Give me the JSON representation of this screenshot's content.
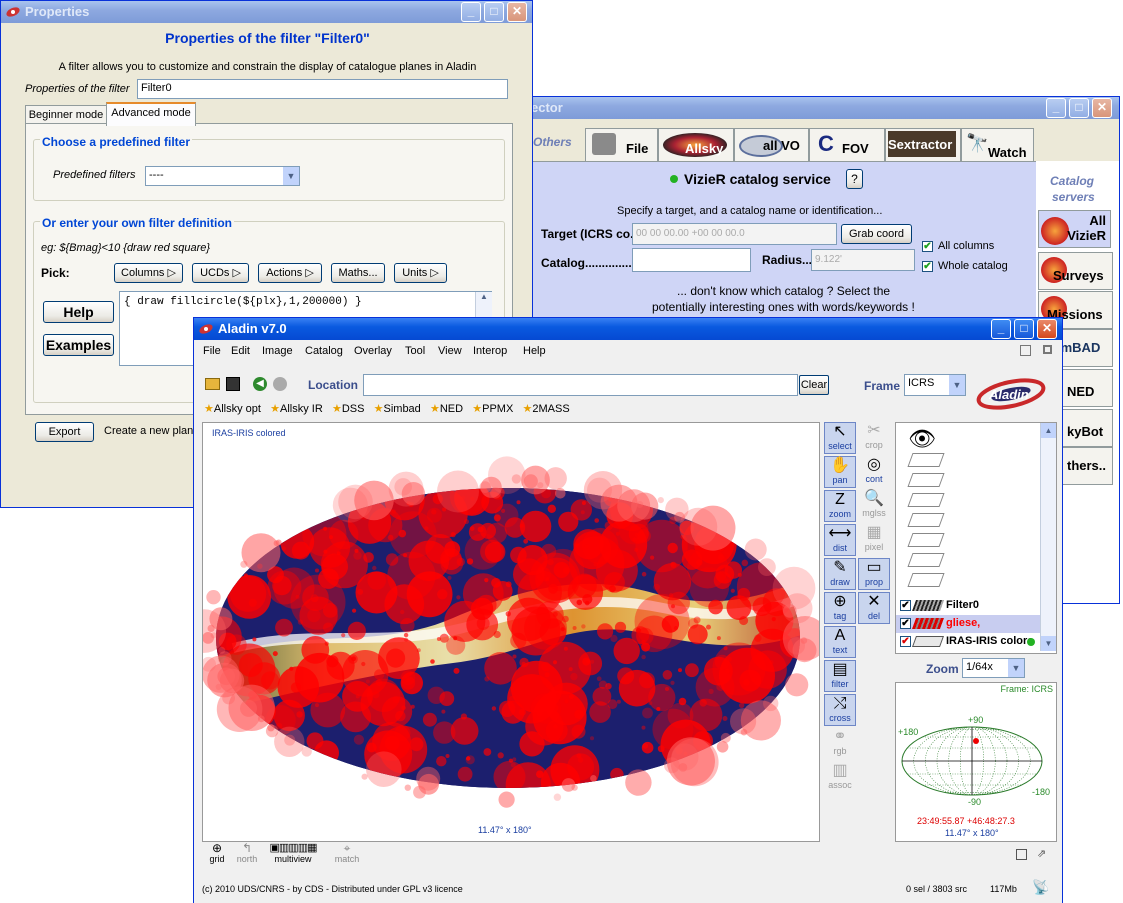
{
  "props": {
    "title": "Properties",
    "heading": "Properties of the filter \"Filter0\"",
    "description": "A filter allows you to customize and constrain the display of catalogue planes in Aladin",
    "name_label": "Properties of the filter",
    "name_value": "Filter0",
    "tab_beginner": "Beginner mode",
    "tab_advanced": "Advanced mode",
    "section1": "Choose a predefined filter",
    "predefined_label": "Predefined filters",
    "predefined_value": "----",
    "section2": "Or enter your own filter definition",
    "example": "eg: ${Bmag}<10 {draw red square}",
    "pick": "Pick:",
    "pick_buttons": [
      "Columns ▷",
      "UCDs ▷",
      "Actions ▷",
      "Maths...",
      "Units ▷"
    ],
    "help": "Help",
    "examples": "Examples",
    "filter_text": "{ draw fillcircle(${plx},1,200000) }",
    "export": "Export",
    "create": "Create a new plane"
  },
  "server": {
    "title_partial": "ector",
    "tabs": [
      "Others",
      "File",
      "Allsky",
      "all VO",
      "FOV",
      "Sextractor",
      "Watch"
    ],
    "service": "VizieR catalog service",
    "help": "?",
    "intro": "Specify a target, and a catalog name or identification...",
    "target_label": "Target (ICRS co.",
    "target_placeholder": "00 00 00.00 +00 00 00.0",
    "grab": "Grab coord",
    "catalog_label": "Catalog...............",
    "radius_label": "Radius...",
    "radius_value": "9.122'",
    "all_columns": "All columns",
    "whole_catalog": "Whole catalog",
    "hint1": "... don't know which catalog ? Select the",
    "hint2": "potentially interesting ones with words/keywords !",
    "servers_title1": "Catalog",
    "servers_title2": "servers",
    "servers": [
      "All\nVizieR",
      "Surveys",
      "Missions",
      "imBAD",
      "NED",
      "kyBot",
      "thers.."
    ]
  },
  "aladin": {
    "title": "Aladin v7.0",
    "menu": [
      "File",
      "Edit",
      "Image",
      "Catalog",
      "Overlay",
      "Tool",
      "View",
      "Interop",
      "Help"
    ],
    "location_label": "Location",
    "location_value": "",
    "clear": "Clear",
    "frame_label": "Frame",
    "frame_value": "ICRS",
    "logo": "Aladin",
    "bookmarks": [
      "Allsky opt",
      "Allsky IR",
      "DSS",
      "Simbad",
      "NED",
      "PPMX",
      "2MASS"
    ],
    "image_label": "IRAS-IRIS colored",
    "fov_label": "11.47° x 180°",
    "tools": [
      {
        "id": "select",
        "label": "select",
        "glyph": "↖"
      },
      {
        "id": "crop",
        "label": "crop",
        "glyph": "✂"
      },
      {
        "id": "pan",
        "label": "pan",
        "glyph": "✋"
      },
      {
        "id": "cont",
        "label": "cont",
        "glyph": "◎"
      },
      {
        "id": "zoom",
        "label": "zoom",
        "glyph": "Z"
      },
      {
        "id": "mglss",
        "label": "mglss",
        "glyph": "🔍"
      },
      {
        "id": "dist",
        "label": "dist",
        "glyph": "⟷"
      },
      {
        "id": "pixel",
        "label": "pixel",
        "glyph": "▦"
      },
      {
        "id": "draw",
        "label": "draw",
        "glyph": "✎"
      },
      {
        "id": "prop",
        "label": "prop",
        "glyph": "▭"
      },
      {
        "id": "tag",
        "label": "tag",
        "glyph": "⊕"
      },
      {
        "id": "del",
        "label": "del",
        "glyph": "✕"
      },
      {
        "id": "text",
        "label": "text",
        "glyph": "A"
      },
      {
        "id": "filter",
        "label": "filter",
        "glyph": "▤"
      },
      {
        "id": "cross",
        "label": "cross",
        "glyph": "⤭"
      },
      {
        "id": "rgb",
        "label": "rgb",
        "glyph": "⚭"
      },
      {
        "id": "assoc",
        "label": "assoc",
        "glyph": "▥"
      }
    ],
    "planes": [
      {
        "name": "Filter0",
        "color": "#000000"
      },
      {
        "name": "gliese,",
        "color": "#ff0000"
      },
      {
        "name": "IRAS-IRIS colore",
        "color": "#000000"
      }
    ],
    "zoom_label": "Zoom",
    "zoom_value": "1/64x",
    "frame_icrs": "Frame: ICRS",
    "grid_labels": {
      "top": "+90",
      "left": "+180",
      "bottom": "-90",
      "right": "-180"
    },
    "coord": "23:49:55.87 +46:48:27.3",
    "nav_fov": "11.47° x 180°",
    "bottom_tools": [
      "grid",
      "north",
      "multiview",
      "match"
    ],
    "status": "(c) 2010 UDS/CNRS - by CDS - Distributed under GPL v3 licence",
    "src_count": "0 sel / 3803 src",
    "memory": "117Mb"
  },
  "colors": {
    "xp_blue": "#0a5ae0",
    "link_blue": "#0033cc",
    "panel": "#ece9d8",
    "catalog_bg": "#cfd5f6",
    "source_red": "#ff0000"
  }
}
